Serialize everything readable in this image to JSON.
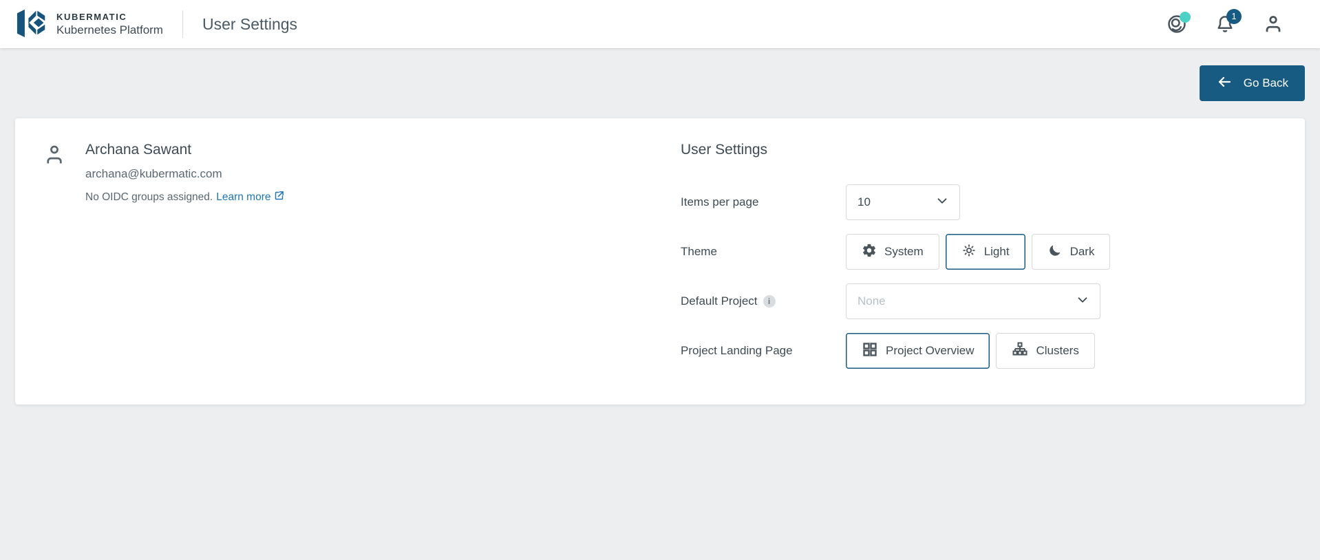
{
  "header": {
    "brand_name": "KUBERMATIC",
    "brand_subtitle": "Kubernetes Platform",
    "page_title": "User Settings",
    "notifications_count": "1"
  },
  "toolbar": {
    "go_back_label": "Go Back"
  },
  "user_card": {
    "name": "Archana Sawant",
    "email": "archana@kubermatic.com",
    "oidc_text": "No OIDC groups assigned.",
    "learn_more_label": "Learn more"
  },
  "settings": {
    "title": "User Settings",
    "items_per_page": {
      "label": "Items per page",
      "value": "10"
    },
    "theme": {
      "label": "Theme",
      "options": [
        {
          "label": "System",
          "selected": false
        },
        {
          "label": "Light",
          "selected": true
        },
        {
          "label": "Dark",
          "selected": false
        }
      ]
    },
    "default_project": {
      "label": "Default Project",
      "placeholder": "None"
    },
    "landing_page": {
      "label": "Project Landing Page",
      "options": [
        {
          "label": "Project Overview",
          "selected": true
        },
        {
          "label": "Clusters",
          "selected": false
        }
      ]
    }
  },
  "icons": {
    "logo": "kubermatic-k-mark",
    "changelog": "wheel-circle-with-teal-dot",
    "notifications": "bell-with-count-badge",
    "account": "person-outline",
    "go_back": "arrow-left",
    "avatar": "person-outline",
    "learn_more_external": "external-link",
    "items_per_page_select": "chevron-down",
    "theme_system": "gear",
    "theme_light": "sun",
    "theme_dark": "moon-crescent",
    "default_project_info": "info-circle",
    "default_project_select": "chevron-down",
    "landing_overview": "grid-2x2",
    "landing_clusters": "sitemap-hierarchy"
  },
  "colors": {
    "primary": "#175a82",
    "accent_teal": "#4dd0c5",
    "link": "#2076b4",
    "page_background": "#eceef0"
  }
}
